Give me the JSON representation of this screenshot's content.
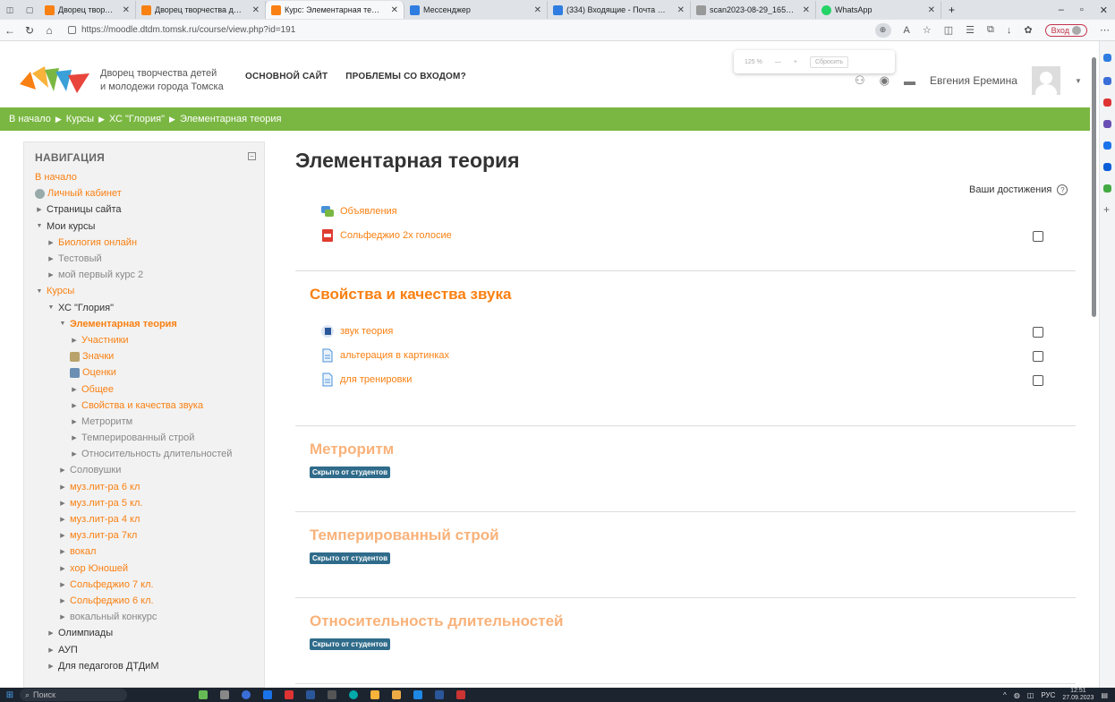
{
  "browser": {
    "tabs": [
      {
        "title": "Дворец творчества детей и м",
        "active": false
      },
      {
        "title": "Дворец творчества детей и м",
        "active": false
      },
      {
        "title": "Курс: Элементарная теория",
        "active": true
      },
      {
        "title": "Мессенджер",
        "active": false
      },
      {
        "title": "(334) Входящие - Почта Mail.r",
        "active": false
      },
      {
        "title": "scan2023-08-29_1655501.pdf",
        "active": false
      },
      {
        "title": "WhatsApp",
        "active": false
      }
    ],
    "url": "https://moodle.dtdm.tomsk.ru/course/view.php?id=191",
    "signin_label": "Вход"
  },
  "zoom_popup": {
    "level": "125 %",
    "minus": "—",
    "plus": "+",
    "reset": "Сбросить"
  },
  "header": {
    "brand_line1": "Дворец творчества детей",
    "brand_line2": "и молодежи города Томска",
    "nav": [
      "ОСНОВНОЙ САЙТ",
      "ПРОБЛЕМЫ СО ВХОДОМ?"
    ],
    "user_name": "Евгения Еремина"
  },
  "breadcrumb": [
    "В начало",
    "Курсы",
    "ХС \"Глория\"",
    "Элементарная теория"
  ],
  "navigation": {
    "title": "НАВИГАЦИЯ",
    "items": [
      {
        "label": "В начало",
        "indent": 0,
        "style": "orange",
        "toggle": "",
        "icon": ""
      },
      {
        "label": "Личный кабинет",
        "indent": 0,
        "style": "orange",
        "toggle": "",
        "icon": "dashboard"
      },
      {
        "label": "Страницы сайта",
        "indent": 0,
        "style": "",
        "toggle": "▶",
        "icon": ""
      },
      {
        "label": "Мои курсы",
        "indent": 0,
        "style": "",
        "toggle": "▼",
        "icon": ""
      },
      {
        "label": "Биология онлайн",
        "indent": 1,
        "style": "orange",
        "toggle": "▶",
        "icon": ""
      },
      {
        "label": "Тестовый",
        "indent": 1,
        "style": "grey",
        "toggle": "▶",
        "icon": ""
      },
      {
        "label": "мой первый курс 2",
        "indent": 1,
        "style": "grey",
        "toggle": "▶",
        "icon": ""
      },
      {
        "label": "Курсы",
        "indent": 0,
        "style": "orange",
        "toggle": "▼",
        "icon": ""
      },
      {
        "label": "ХС \"Глория\"",
        "indent": 1,
        "style": "",
        "toggle": "▼",
        "icon": ""
      },
      {
        "label": "Элементарная теория",
        "indent": 2,
        "style": "orange bold",
        "toggle": "▼",
        "icon": ""
      },
      {
        "label": "Участники",
        "indent": 3,
        "style": "orange",
        "toggle": "▶",
        "icon": ""
      },
      {
        "label": "Значки",
        "indent": 3,
        "style": "orange",
        "toggle": "",
        "icon": "trophy"
      },
      {
        "label": "Оценки",
        "indent": 3,
        "style": "orange",
        "toggle": "",
        "icon": "table"
      },
      {
        "label": "Общее",
        "indent": 3,
        "style": "orange",
        "toggle": "▶",
        "icon": ""
      },
      {
        "label": "Свойства и качества звука",
        "indent": 3,
        "style": "orange",
        "toggle": "▶",
        "icon": ""
      },
      {
        "label": "Метроритм",
        "indent": 3,
        "style": "grey",
        "toggle": "▶",
        "icon": ""
      },
      {
        "label": "Темперированный строй",
        "indent": 3,
        "style": "grey",
        "toggle": "▶",
        "icon": ""
      },
      {
        "label": "Относительность длительностей",
        "indent": 3,
        "style": "grey",
        "toggle": "▶",
        "icon": ""
      },
      {
        "label": "Соловушки",
        "indent": 2,
        "style": "grey",
        "toggle": "▶",
        "icon": ""
      },
      {
        "label": "муз.лит-ра 6 кл",
        "indent": 2,
        "style": "orange",
        "toggle": "▶",
        "icon": ""
      },
      {
        "label": "муз.лит-ра 5 кл.",
        "indent": 2,
        "style": "orange",
        "toggle": "▶",
        "icon": ""
      },
      {
        "label": "муз.лит-ра 4 кл",
        "indent": 2,
        "style": "orange",
        "toggle": "▶",
        "icon": ""
      },
      {
        "label": "муз.лит-ра 7кл",
        "indent": 2,
        "style": "orange",
        "toggle": "▶",
        "icon": ""
      },
      {
        "label": "вокал",
        "indent": 2,
        "style": "orange",
        "toggle": "▶",
        "icon": ""
      },
      {
        "label": "хор Юношей",
        "indent": 2,
        "style": "orange",
        "toggle": "▶",
        "icon": ""
      },
      {
        "label": "Сольфеджио 7 кл.",
        "indent": 2,
        "style": "orange",
        "toggle": "▶",
        "icon": ""
      },
      {
        "label": "Сольфеджио 6 кл.",
        "indent": 2,
        "style": "orange",
        "toggle": "▶",
        "icon": ""
      },
      {
        "label": "вокальный конкурс",
        "indent": 2,
        "style": "grey",
        "toggle": "▶",
        "icon": ""
      },
      {
        "label": "Олимпиады",
        "indent": 1,
        "style": "",
        "toggle": "▶",
        "icon": ""
      },
      {
        "label": "АУП",
        "indent": 1,
        "style": "",
        "toggle": "▶",
        "icon": ""
      },
      {
        "label": "Для педагогов ДТДиМ",
        "indent": 1,
        "style": "",
        "toggle": "▶",
        "icon": ""
      }
    ]
  },
  "course": {
    "title": "Элементарная теория",
    "achievements_label": "Ваши достижения",
    "general": [
      {
        "label": "Объявления",
        "icon": "forum",
        "checkbox": false
      },
      {
        "label": "Сольфеджио 2х голосие",
        "icon": "pdf",
        "checkbox": true
      }
    ],
    "sections": [
      {
        "title": "Свойства и качества звука",
        "hidden": false,
        "activities": [
          {
            "label": "звук теория",
            "icon": "word",
            "checkbox": true
          },
          {
            "label": "альтерация в картинках",
            "icon": "page",
            "checkbox": true
          },
          {
            "label": "для тренировки",
            "icon": "page",
            "checkbox": true
          }
        ]
      },
      {
        "title": "Метроритм",
        "hidden": true,
        "activities": []
      },
      {
        "title": "Темперированный строй",
        "hidden": true,
        "activities": []
      },
      {
        "title": "Относительность длительностей",
        "hidden": true,
        "activities": []
      }
    ],
    "hidden_badge": "Скрыто от студентов"
  },
  "taskbar": {
    "search_placeholder": "Поиск",
    "lang": "РУС",
    "time": "12:51",
    "date": "27.09.2023"
  },
  "colors": {
    "accent": "#f98012",
    "breadcrumb_bg": "#7ab742",
    "badge_bg": "#2f6b8a"
  }
}
